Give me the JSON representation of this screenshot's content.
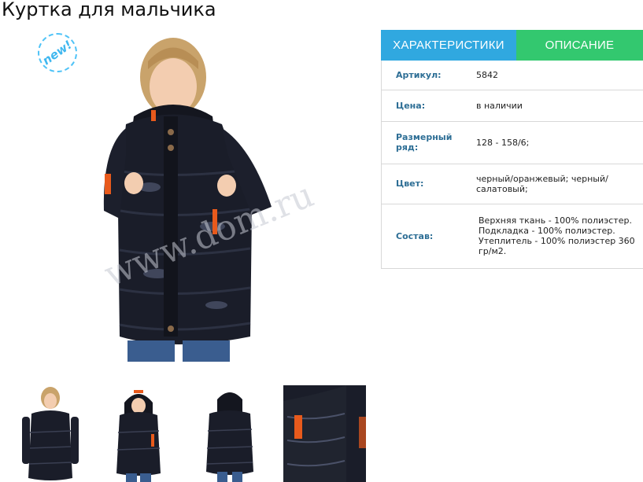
{
  "title": "Куртка для мальчика",
  "badge": "new!",
  "watermark": "www.dom.ru",
  "tabs": [
    {
      "label": "ХАРАКТЕРИСТИКИ",
      "active": true,
      "color": "#30a8e0"
    },
    {
      "label": "ОПИСАНИЕ",
      "active": false,
      "color": "#33c86f"
    }
  ],
  "specs": [
    {
      "key": "Артикул:",
      "value": "5842"
    },
    {
      "key": "Цена:",
      "value": "в наличии"
    },
    {
      "key": "Размерный ряд:",
      "value": "128 - 158/6;"
    },
    {
      "key": "Цвет:",
      "value": "черный/оранжевый; черный/ салатовый;"
    },
    {
      "key": "Состав:",
      "value": "Верхняя ткань - 100% полиэстер. Подкладка - 100% полиэстер. Утеплитель - 100% полиэстер 360 гр/м2."
    }
  ],
  "thumbnails": [
    "front-view",
    "hood-up-view",
    "back-view",
    "sleeve-detail-view"
  ]
}
